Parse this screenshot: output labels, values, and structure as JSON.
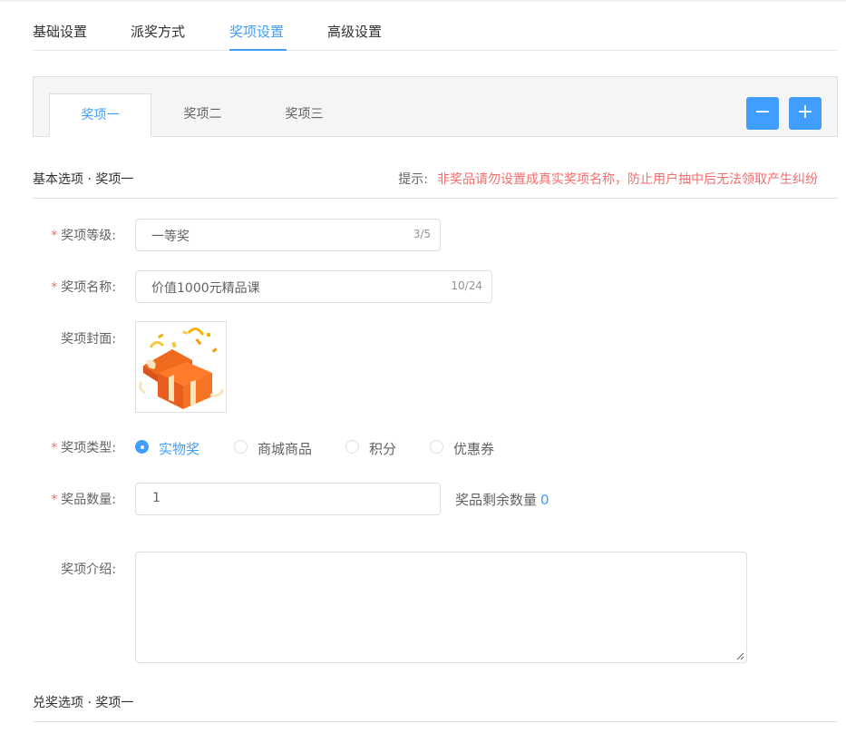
{
  "main_tabs": [
    {
      "label": "基础设置"
    },
    {
      "label": "派奖方式"
    },
    {
      "label": "奖项设置"
    },
    {
      "label": "高级设置"
    }
  ],
  "active_main_tab": "奖项设置",
  "award_tabs": [
    {
      "label": "奖项一"
    },
    {
      "label": "奖项二"
    },
    {
      "label": "奖项三"
    }
  ],
  "active_award_tab": "奖项一",
  "buttons": {
    "remove": "−",
    "add": "+"
  },
  "basic_section": {
    "title": "基本选项 · 奖项一",
    "hint_label": "提示:",
    "hint_text": "非奖品请勿设置成真实奖项名称，防止用户抽中后无法领取产生纠纷"
  },
  "form": {
    "level": {
      "label": "奖项等级:",
      "value": "一等奖",
      "count": "3/5",
      "required": "*"
    },
    "name": {
      "label": "奖项名称:",
      "value": "价值1000元精品课",
      "count": "10/24",
      "required": "*"
    },
    "cover": {
      "label": "奖项封面:",
      "image": "gift-box-icon"
    },
    "type": {
      "label": "奖项类型:",
      "required": "*",
      "options": [
        {
          "label": "实物奖",
          "checked": true
        },
        {
          "label": "商城商品",
          "checked": false
        },
        {
          "label": "积分",
          "checked": false
        },
        {
          "label": "优惠券",
          "checked": false
        }
      ]
    },
    "quantity": {
      "label": "奖品数量:",
      "value": "1",
      "required": "*",
      "remaining_label": "奖品剩余数量",
      "remaining_value": "0"
    },
    "intro": {
      "label": "奖项介绍:",
      "value": ""
    }
  },
  "redeem_section": {
    "title": "兑奖选项 · 奖项一"
  },
  "colors": {
    "accent": "#409eff",
    "danger": "#f56c6c",
    "border": "#dcdfe6",
    "text": "#606266"
  }
}
